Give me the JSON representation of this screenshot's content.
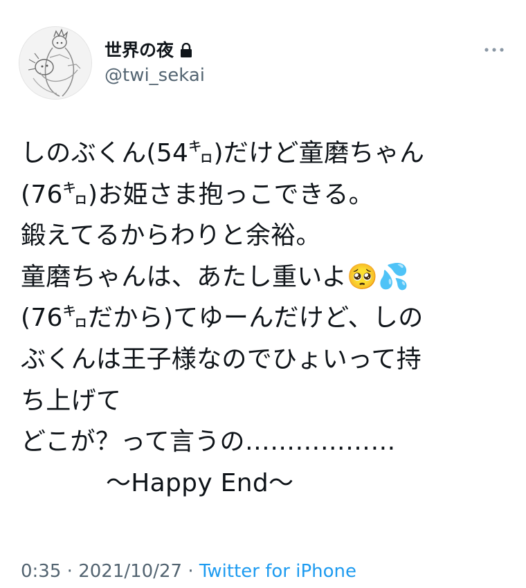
{
  "author": {
    "display_name": "世界の夜",
    "handle": "@twi_sekai",
    "avatar_icon": "avatar-icon",
    "protected_icon": "lock-icon"
  },
  "menu": {
    "more_icon": "more-icon"
  },
  "body": {
    "lines": [
      "しのぶくん(54㌔)だけど童磨ちゃん",
      "(76㌔)お姫さま抱っこできる。",
      "鍛えてるからわりと余裕。",
      "童磨ちゃんは、あたし重いよ🥺💦",
      "(76㌔だから)てゆーんだけど、しの",
      "ぶくんは王子様なのでひょいって持",
      "ち上げて",
      "どこが？って言うの………………",
      "〜Happy End〜"
    ]
  },
  "meta": {
    "time": "0:35",
    "separator": "·",
    "date": "2021/10/27",
    "source": "Twitter for iPhone"
  },
  "colors": {
    "text": "#0f1419",
    "secondary": "#536471",
    "link": "#1d9bf0"
  }
}
